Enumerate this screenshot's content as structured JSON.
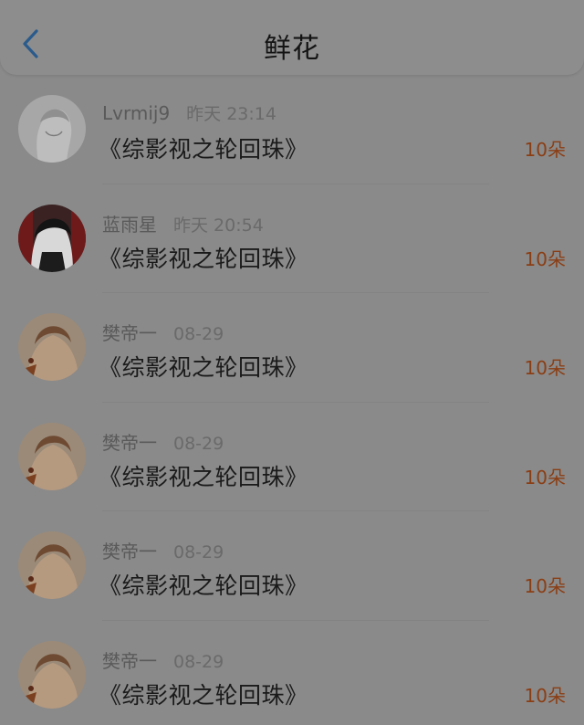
{
  "header": {
    "title": "鲜花",
    "accent_color": "#2a5b8c"
  },
  "items": [
    {
      "username": "Lvrmij9",
      "time": "昨天 23:14",
      "book": "《综影视之轮回珠》",
      "count": "10朵"
    },
    {
      "username": "蓝雨星",
      "time": "昨天 20:54",
      "book": "《综影视之轮回珠》",
      "count": "10朵"
    },
    {
      "username": "樊帝一",
      "time": "08-29",
      "book": "《综影视之轮回珠》",
      "count": "10朵"
    },
    {
      "username": "樊帝一",
      "time": "08-29",
      "book": "《综影视之轮回珠》",
      "count": "10朵"
    },
    {
      "username": "樊帝一",
      "time": "08-29",
      "book": "《综影视之轮回珠》",
      "count": "10朵"
    },
    {
      "username": "樊帝一",
      "time": "08-29",
      "book": "《综影视之轮回珠》",
      "count": "10朵"
    }
  ]
}
